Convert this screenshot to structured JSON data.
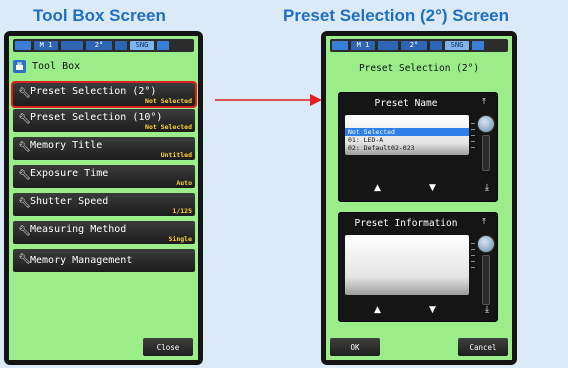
{
  "captions": {
    "left": "Tool Box Screen",
    "right": "Preset Selection (2°) Screen"
  },
  "status_bar": {
    "mode": "M 1",
    "angle": "2°",
    "sync": "SNG"
  },
  "toolbox": {
    "title": "Tool Box",
    "items": [
      {
        "label": "Preset Selection (2°)",
        "value": "Not Selected"
      },
      {
        "label": "Preset Selection (10°)",
        "value": "Not Selected"
      },
      {
        "label": "Memory Title",
        "value": "Untitled"
      },
      {
        "label": "Exposure Time",
        "value": "Auto"
      },
      {
        "label": "Shutter Speed",
        "value": "1/125"
      },
      {
        "label": "Measuring Method",
        "value": "Single"
      },
      {
        "label": "Memory Management",
        "value": ""
      }
    ],
    "close_label": "Close"
  },
  "preset_screen": {
    "title": "Preset Selection (2°)",
    "name_panel_title": "Preset Name",
    "list": [
      "Not Selected",
      "01: LED-A",
      "02: Default02-023"
    ],
    "info_panel_title": "Preset Information",
    "ok_label": "OK",
    "cancel_label": "Cancel"
  },
  "colors": {
    "screen_bg": "#9bed8a",
    "caption": "#1f6fc4",
    "highlight": "#e02020",
    "value_text": "#ffd42a",
    "selected_row": "#2f7fe8"
  }
}
